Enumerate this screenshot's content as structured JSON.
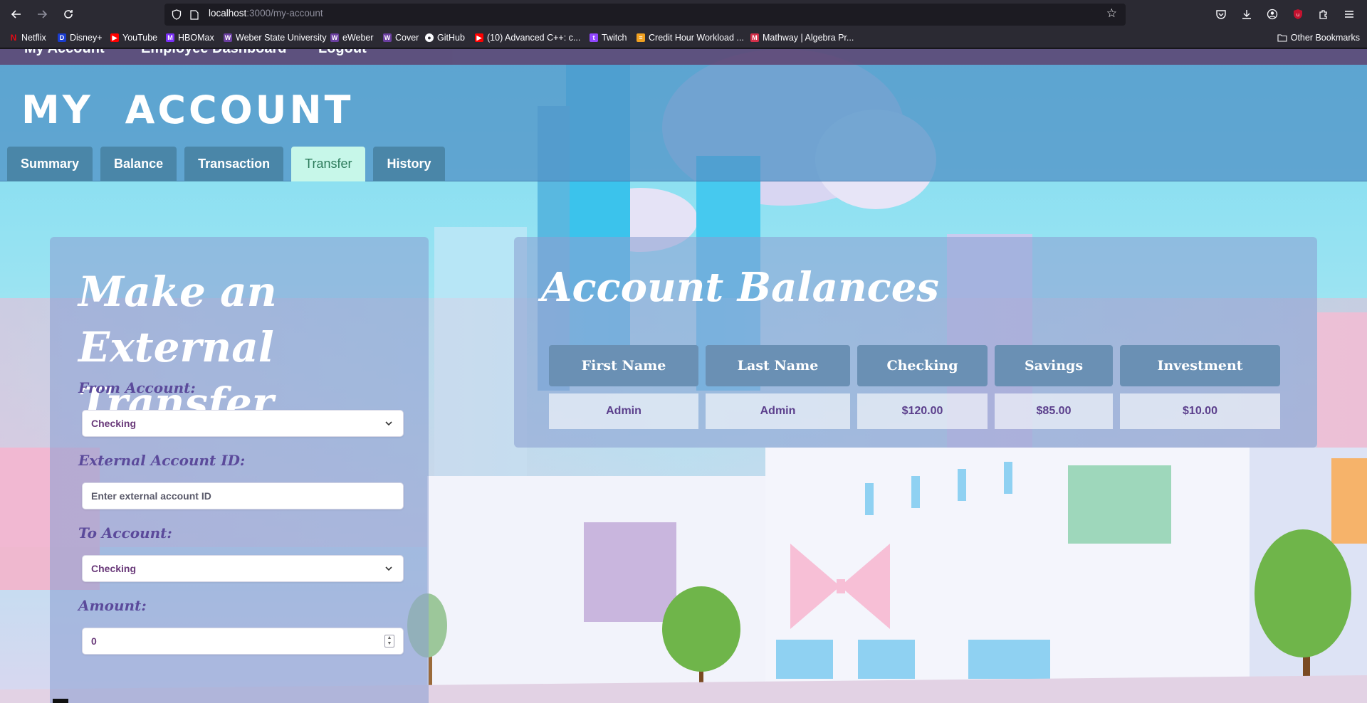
{
  "browser": {
    "url_host": "localhost",
    "url_rest": ":3000/my-account",
    "bookmarks": [
      {
        "label": "Netflix",
        "color": "#e50914"
      },
      {
        "label": "Disney+",
        "color": "#1a3ccf"
      },
      {
        "label": "YouTube",
        "color": "#ff0000"
      },
      {
        "label": "HBOMax",
        "color": "#7b2ff7"
      },
      {
        "label": "Weber State University",
        "color": "#6b3fa0"
      },
      {
        "label": "eWeber",
        "color": "#6b3fa0"
      },
      {
        "label": "Cover",
        "color": "#6b3fa0"
      },
      {
        "label": "GitHub",
        "color": "#ffffff"
      },
      {
        "label": "(10) Advanced C++: c...",
        "color": "#ff0000"
      },
      {
        "label": "Twitch",
        "color": "#9146ff"
      },
      {
        "label": "Credit Hour Workload ...",
        "color": "#f0a020"
      },
      {
        "label": "Mathway | Algebra Pr...",
        "color": "#d4304a"
      }
    ],
    "other_bookmarks": "Other Bookmarks"
  },
  "site_nav": {
    "items": [
      "My Account",
      "Employee Dashboard",
      "Logout"
    ]
  },
  "page": {
    "title": "MY ACCOUNT",
    "tabs": [
      {
        "label": "Summary",
        "active": false
      },
      {
        "label": "Balance",
        "active": false
      },
      {
        "label": "Transaction",
        "active": false
      },
      {
        "label": "Transfer",
        "active": true
      },
      {
        "label": "History",
        "active": false
      }
    ]
  },
  "transfer_form": {
    "title": "Make an External Transfer",
    "from_label": "From Account:",
    "from_value": "Checking",
    "external_label": "External Account ID:",
    "external_placeholder": "Enter external account ID",
    "to_label": "To Account:",
    "to_value": "Checking",
    "amount_label": "Amount:",
    "amount_value": "0"
  },
  "balances": {
    "title": "Account Balances",
    "columns": [
      "First Name",
      "Last Name",
      "Checking",
      "Savings",
      "Investment"
    ],
    "rows": [
      [
        "Admin",
        "Admin",
        "$120.00",
        "$85.00",
        "$10.00"
      ]
    ]
  },
  "colors": {
    "accent_tab_active": "#c7f7e9",
    "tab_bg": "#4a86a8",
    "label_purple": "#5b4a9b",
    "table_header": "#6a90b4"
  }
}
